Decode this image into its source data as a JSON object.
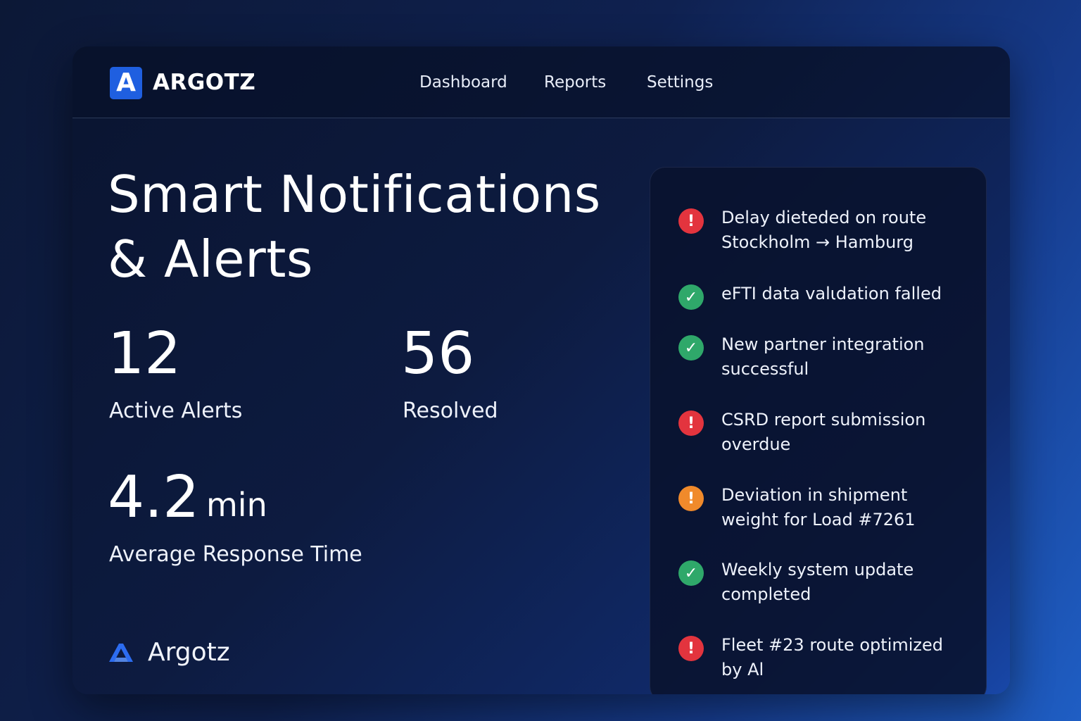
{
  "brand": {
    "name": "ARGOTZ",
    "logo_letter": "A",
    "footer_name": "Argotz",
    "accent": "#1f5fe0"
  },
  "nav": {
    "items": [
      "Dashboard",
      "Reports",
      "Settings"
    ]
  },
  "headline": {
    "line1": "Smart Notifications",
    "line2": "& Alerts"
  },
  "stats": {
    "active": {
      "value": "12",
      "label": "Active Alerts"
    },
    "resolved": {
      "value": "56",
      "label": "Resolved"
    },
    "response": {
      "value": "4.2",
      "unit": "min",
      "label": "Average Response Time"
    }
  },
  "notifications": [
    {
      "status": "error",
      "icon": "exclamation-icon",
      "color": "#e3343e",
      "symbol": "!",
      "text": "Delay dieteded on route Stockholm → Hamburg"
    },
    {
      "status": "success",
      "icon": "checkmark-icon",
      "color": "#2fa86a",
      "symbol": "✓",
      "text": "eFTI data valιdation falled"
    },
    {
      "status": "success",
      "icon": "checkmark-icon",
      "color": "#2fa86a",
      "symbol": "✓",
      "text": "New partner integration successful"
    },
    {
      "status": "error",
      "icon": "exclamation-icon",
      "color": "#e3343e",
      "symbol": "!",
      "text": "CSRD report submission overdue"
    },
    {
      "status": "warning",
      "icon": "exclamation-icon",
      "color": "#f08a2b",
      "symbol": "!",
      "text": "Deviation in shipment weight for Load #7261"
    },
    {
      "status": "success",
      "icon": "checkmark-icon",
      "color": "#2fa86a",
      "symbol": "✓",
      "text": "Weekly system update completed"
    },
    {
      "status": "error",
      "icon": "exclamation-icon",
      "color": "#e3343e",
      "symbol": "!",
      "text": "Fleet #23 route optimized by Al"
    }
  ]
}
